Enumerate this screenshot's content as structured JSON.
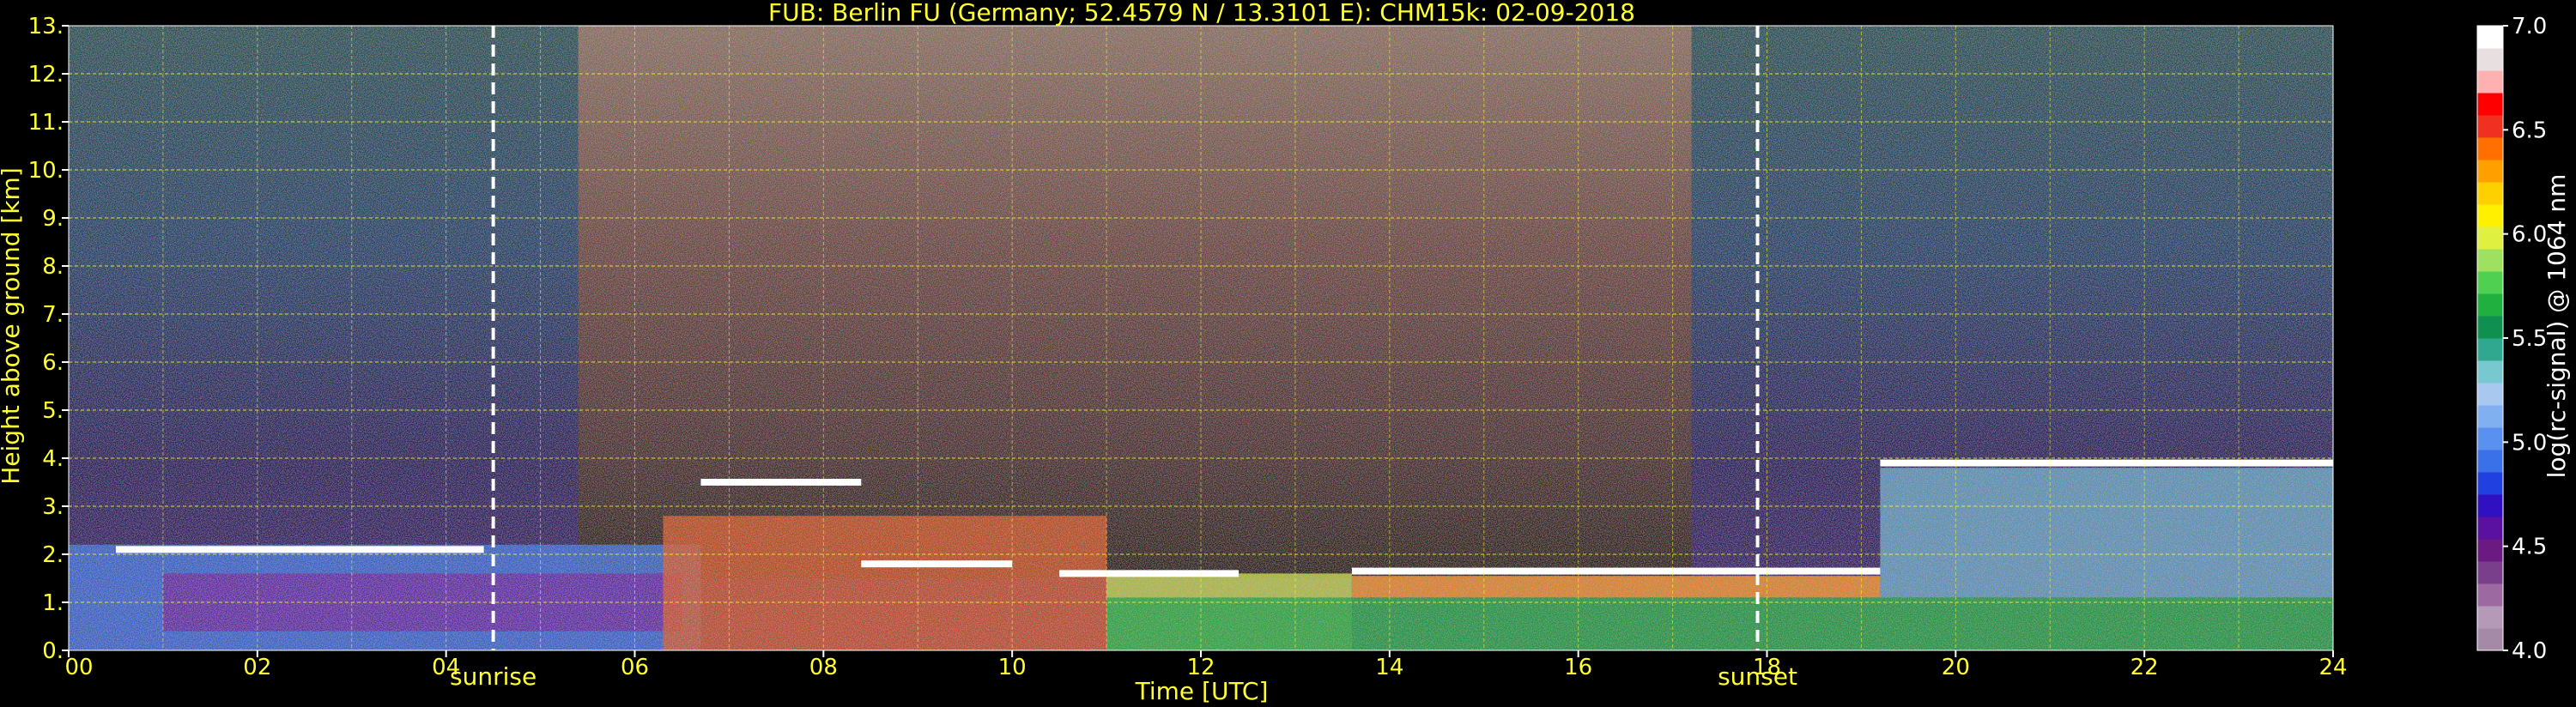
{
  "chart_data": {
    "type": "heatmap",
    "title": "FUB: Berlin FU (Germany; 52.4579 N / 13.3101 E):    CHM15k: 02-09-2018",
    "xlabel": "Time [UTC]",
    "ylabel": "Height above ground [km]",
    "xlim": [
      0,
      24
    ],
    "ylim": [
      0,
      13
    ],
    "x_ticks": [
      "00",
      "02",
      "04",
      "06",
      "08",
      "10",
      "12",
      "14",
      "16",
      "18",
      "20",
      "22",
      "24"
    ],
    "y_ticks": [
      "0.",
      "1.",
      "2.",
      "3.",
      "4.",
      "5.",
      "6.",
      "7.",
      "8.",
      "9.",
      "10.",
      "11.",
      "12.",
      "13."
    ],
    "grid": true,
    "events": [
      {
        "label": "sunrise",
        "time": 4.5
      },
      {
        "label": "sunset",
        "time": 17.9
      }
    ],
    "colorbar": {
      "label": "log(rc-signal) @ 1064 nm",
      "range": [
        4.0,
        7.0
      ],
      "ticks": [
        "4.0",
        "4.5",
        "5.0",
        "5.5",
        "6.0",
        "6.5",
        "7.0"
      ],
      "colors": [
        "#a58aa8",
        "#b59ab8",
        "#9c6aa0",
        "#7a3f8a",
        "#6a1a80",
        "#5a10a0",
        "#3010c0",
        "#2040e0",
        "#3a70e8",
        "#5a90f0",
        "#80b0f0",
        "#a8c8f0",
        "#78c8d0",
        "#30a890",
        "#109050",
        "#20b040",
        "#50d050",
        "#a0e060",
        "#e0f040",
        "#fff000",
        "#ffd000",
        "#ffa000",
        "#ff7000",
        "#f03020",
        "#ff0000",
        "#ffb0b0",
        "#e8e0e0",
        "#ffffff"
      ]
    },
    "cloud_base_layers": [
      {
        "start": 0.5,
        "end": 4.4,
        "height": 2.1
      },
      {
        "start": 6.7,
        "end": 8.4,
        "height": 3.5
      },
      {
        "start": 8.4,
        "end": 10.0,
        "height": 1.8
      },
      {
        "start": 10.5,
        "end": 12.4,
        "height": 1.6
      },
      {
        "start": 13.6,
        "end": 19.2,
        "height": 1.65
      },
      {
        "start": 19.2,
        "end": 24.0,
        "height": 3.9
      }
    ]
  }
}
